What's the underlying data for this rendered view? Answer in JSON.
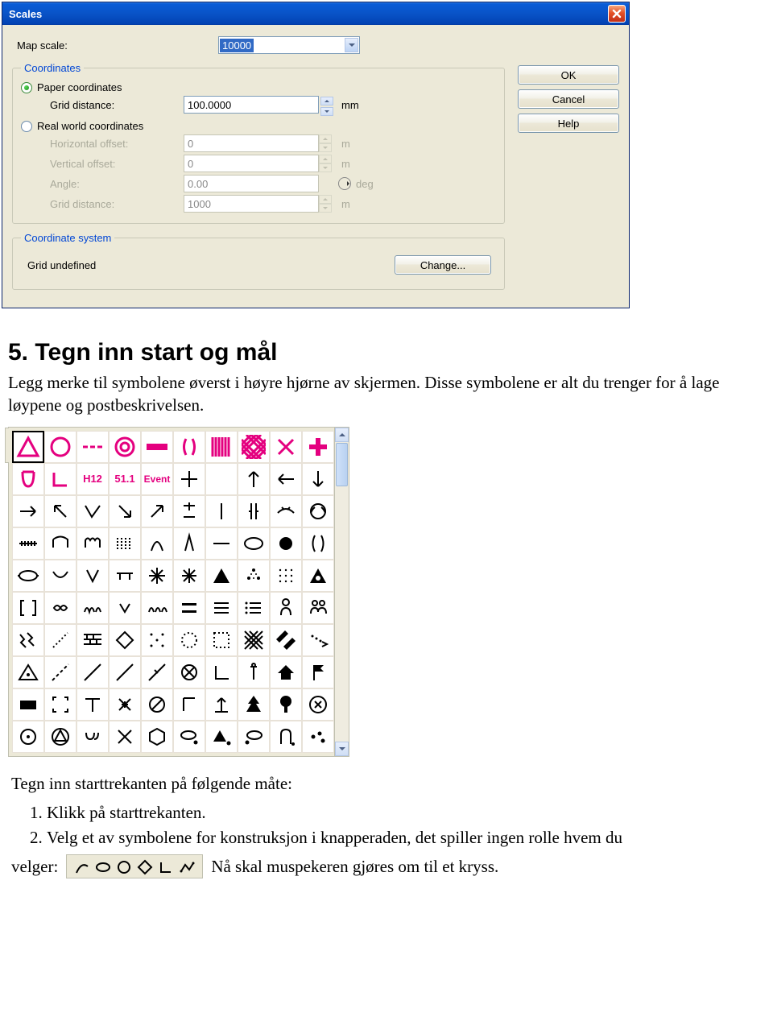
{
  "dialog": {
    "title": "Scales",
    "map_scale_label": "Map scale:",
    "map_scale_value": "10000",
    "buttons": {
      "ok": "OK",
      "cancel": "Cancel",
      "help": "Help"
    },
    "coords": {
      "legend": "Coordinates",
      "paper_label": "Paper coordinates",
      "grid_dist_label": "Grid distance:",
      "grid_dist_value": "100.0000",
      "grid_dist_unit": "mm",
      "real_label": "Real world coordinates",
      "hoff_label": "Horizontal offset:",
      "hoff_value": "0",
      "hoff_unit": "m",
      "voff_label": "Vertical offset:",
      "voff_value": "0",
      "voff_unit": "m",
      "angle_label": "Angle:",
      "angle_value": "0.00",
      "angle_unit": "deg",
      "grid2_label": "Grid distance:",
      "grid2_value": "1000",
      "grid2_unit": "m"
    },
    "coordsys": {
      "legend": "Coordinate system",
      "status": "Grid undefined",
      "change": "Change..."
    }
  },
  "doc": {
    "heading": "5. Tegn inn start og mål",
    "para": "Legg merke til symbolene øverst i høyre hjørne av skjermen. Disse symbolene er alt du trenger for å lage løypene og postbeskrivelsen.",
    "palette_text": {
      "h12": "H12",
      "num": "51.1",
      "event": "Event"
    },
    "steps_intro": "Tegn inn starttrekanten på følgende måte:",
    "step1": "Klikk på starttrekanten.",
    "step2": "Velg et av symbolene for konstruksjon i knapperaden, det spiller ingen rolle hvem du",
    "velger": "velger:",
    "tail": "Nå skal muspekeren gjøres om til et kryss."
  }
}
